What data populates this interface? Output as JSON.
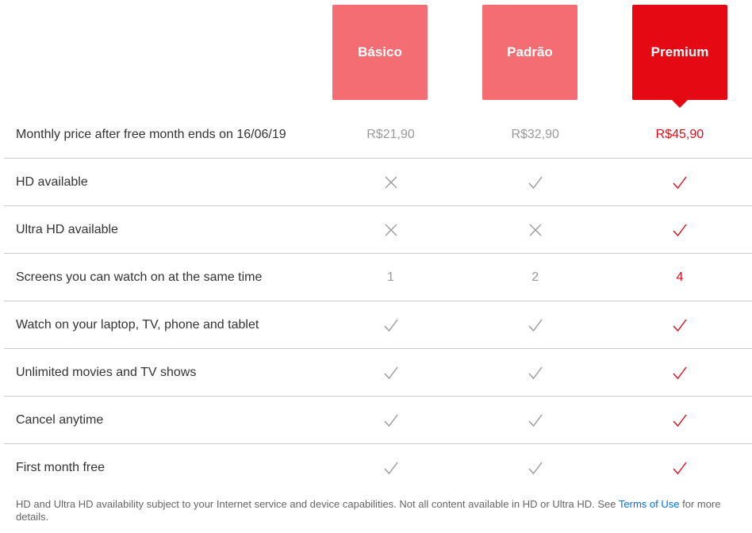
{
  "plans": [
    {
      "name": "Básico"
    },
    {
      "name": "Padrão"
    },
    {
      "name": "Premium"
    }
  ],
  "selected_plan": "Premium",
  "colors": {
    "accent": "#e50914",
    "plan_unselected": "#f46d73",
    "muted": "#999999",
    "link": "#0071eb"
  },
  "rows": [
    {
      "label": "Monthly price after free month ends on 16/06/19",
      "values": [
        "R$21,90",
        "R$32,90",
        "R$45,90"
      ]
    },
    {
      "label": "HD available",
      "values": [
        "cross-icon",
        "check-icon",
        "check-icon"
      ]
    },
    {
      "label": "Ultra HD available",
      "values": [
        "cross-icon",
        "cross-icon",
        "check-icon"
      ]
    },
    {
      "label": "Screens you can watch on at the same time",
      "values": [
        "1",
        "2",
        "4"
      ]
    },
    {
      "label": "Watch on your laptop, TV, phone and tablet",
      "values": [
        "check-icon",
        "check-icon",
        "check-icon"
      ]
    },
    {
      "label": "Unlimited movies and TV shows",
      "values": [
        "check-icon",
        "check-icon",
        "check-icon"
      ]
    },
    {
      "label": "Cancel anytime",
      "values": [
        "check-icon",
        "check-icon",
        "check-icon"
      ]
    },
    {
      "label": "First month free",
      "values": [
        "check-icon",
        "check-icon",
        "check-icon"
      ]
    }
  ],
  "footnote": {
    "text_before": "HD and Ultra HD availability subject to your Internet service and device capabilities. Not all content available in HD or Ultra HD. See ",
    "link": "Terms of Use",
    "text_after": " for more details."
  }
}
